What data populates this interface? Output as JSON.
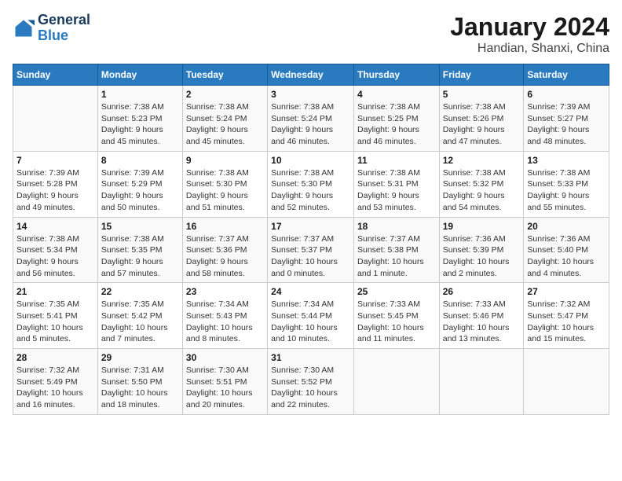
{
  "header": {
    "logo_line1": "General",
    "logo_line2": "Blue",
    "title": "January 2024",
    "subtitle": "Handian, Shanxi, China"
  },
  "columns": [
    "Sunday",
    "Monday",
    "Tuesday",
    "Wednesday",
    "Thursday",
    "Friday",
    "Saturday"
  ],
  "weeks": [
    [
      {
        "day": "",
        "info": ""
      },
      {
        "day": "1",
        "info": "Sunrise: 7:38 AM\nSunset: 5:23 PM\nDaylight: 9 hours\nand 45 minutes."
      },
      {
        "day": "2",
        "info": "Sunrise: 7:38 AM\nSunset: 5:24 PM\nDaylight: 9 hours\nand 45 minutes."
      },
      {
        "day": "3",
        "info": "Sunrise: 7:38 AM\nSunset: 5:24 PM\nDaylight: 9 hours\nand 46 minutes."
      },
      {
        "day": "4",
        "info": "Sunrise: 7:38 AM\nSunset: 5:25 PM\nDaylight: 9 hours\nand 46 minutes."
      },
      {
        "day": "5",
        "info": "Sunrise: 7:38 AM\nSunset: 5:26 PM\nDaylight: 9 hours\nand 47 minutes."
      },
      {
        "day": "6",
        "info": "Sunrise: 7:39 AM\nSunset: 5:27 PM\nDaylight: 9 hours\nand 48 minutes."
      }
    ],
    [
      {
        "day": "7",
        "info": "Sunrise: 7:39 AM\nSunset: 5:28 PM\nDaylight: 9 hours\nand 49 minutes."
      },
      {
        "day": "8",
        "info": "Sunrise: 7:39 AM\nSunset: 5:29 PM\nDaylight: 9 hours\nand 50 minutes."
      },
      {
        "day": "9",
        "info": "Sunrise: 7:38 AM\nSunset: 5:30 PM\nDaylight: 9 hours\nand 51 minutes."
      },
      {
        "day": "10",
        "info": "Sunrise: 7:38 AM\nSunset: 5:30 PM\nDaylight: 9 hours\nand 52 minutes."
      },
      {
        "day": "11",
        "info": "Sunrise: 7:38 AM\nSunset: 5:31 PM\nDaylight: 9 hours\nand 53 minutes."
      },
      {
        "day": "12",
        "info": "Sunrise: 7:38 AM\nSunset: 5:32 PM\nDaylight: 9 hours\nand 54 minutes."
      },
      {
        "day": "13",
        "info": "Sunrise: 7:38 AM\nSunset: 5:33 PM\nDaylight: 9 hours\nand 55 minutes."
      }
    ],
    [
      {
        "day": "14",
        "info": "Sunrise: 7:38 AM\nSunset: 5:34 PM\nDaylight: 9 hours\nand 56 minutes."
      },
      {
        "day": "15",
        "info": "Sunrise: 7:38 AM\nSunset: 5:35 PM\nDaylight: 9 hours\nand 57 minutes."
      },
      {
        "day": "16",
        "info": "Sunrise: 7:37 AM\nSunset: 5:36 PM\nDaylight: 9 hours\nand 58 minutes."
      },
      {
        "day": "17",
        "info": "Sunrise: 7:37 AM\nSunset: 5:37 PM\nDaylight: 10 hours\nand 0 minutes."
      },
      {
        "day": "18",
        "info": "Sunrise: 7:37 AM\nSunset: 5:38 PM\nDaylight: 10 hours\nand 1 minute."
      },
      {
        "day": "19",
        "info": "Sunrise: 7:36 AM\nSunset: 5:39 PM\nDaylight: 10 hours\nand 2 minutes."
      },
      {
        "day": "20",
        "info": "Sunrise: 7:36 AM\nSunset: 5:40 PM\nDaylight: 10 hours\nand 4 minutes."
      }
    ],
    [
      {
        "day": "21",
        "info": "Sunrise: 7:35 AM\nSunset: 5:41 PM\nDaylight: 10 hours\nand 5 minutes."
      },
      {
        "day": "22",
        "info": "Sunrise: 7:35 AM\nSunset: 5:42 PM\nDaylight: 10 hours\nand 7 minutes."
      },
      {
        "day": "23",
        "info": "Sunrise: 7:34 AM\nSunset: 5:43 PM\nDaylight: 10 hours\nand 8 minutes."
      },
      {
        "day": "24",
        "info": "Sunrise: 7:34 AM\nSunset: 5:44 PM\nDaylight: 10 hours\nand 10 minutes."
      },
      {
        "day": "25",
        "info": "Sunrise: 7:33 AM\nSunset: 5:45 PM\nDaylight: 10 hours\nand 11 minutes."
      },
      {
        "day": "26",
        "info": "Sunrise: 7:33 AM\nSunset: 5:46 PM\nDaylight: 10 hours\nand 13 minutes."
      },
      {
        "day": "27",
        "info": "Sunrise: 7:32 AM\nSunset: 5:47 PM\nDaylight: 10 hours\nand 15 minutes."
      }
    ],
    [
      {
        "day": "28",
        "info": "Sunrise: 7:32 AM\nSunset: 5:49 PM\nDaylight: 10 hours\nand 16 minutes."
      },
      {
        "day": "29",
        "info": "Sunrise: 7:31 AM\nSunset: 5:50 PM\nDaylight: 10 hours\nand 18 minutes."
      },
      {
        "day": "30",
        "info": "Sunrise: 7:30 AM\nSunset: 5:51 PM\nDaylight: 10 hours\nand 20 minutes."
      },
      {
        "day": "31",
        "info": "Sunrise: 7:30 AM\nSunset: 5:52 PM\nDaylight: 10 hours\nand 22 minutes."
      },
      {
        "day": "",
        "info": ""
      },
      {
        "day": "",
        "info": ""
      },
      {
        "day": "",
        "info": ""
      }
    ]
  ]
}
